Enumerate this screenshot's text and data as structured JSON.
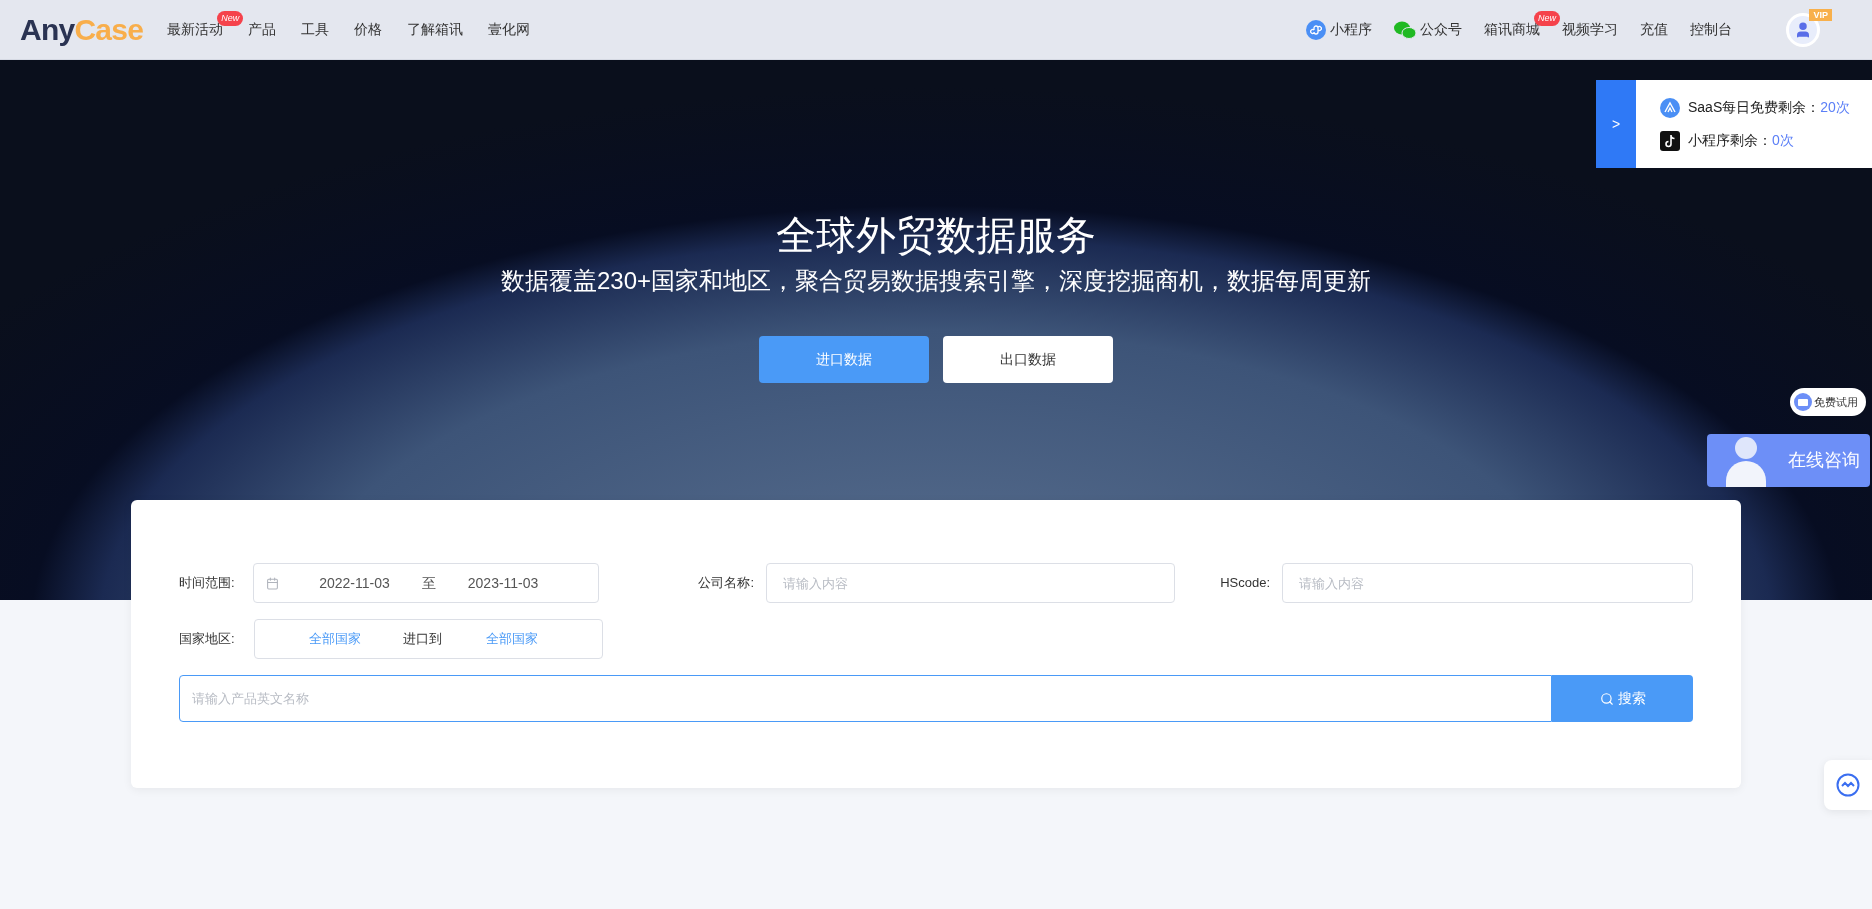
{
  "header": {
    "logo": {
      "first": "A",
      "mid": "ny",
      "last": "Case"
    },
    "nav_left": [
      {
        "label": "最新活动",
        "badge": "New"
      },
      {
        "label": "产品"
      },
      {
        "label": "工具"
      },
      {
        "label": "价格"
      },
      {
        "label": "了解箱讯"
      },
      {
        "label": "壹化网"
      }
    ],
    "nav_right": [
      {
        "kind": "miniprogram",
        "label": "小程序"
      },
      {
        "kind": "wechat",
        "label": "公众号"
      },
      {
        "kind": "plain",
        "label": "箱讯商城",
        "badge": "New"
      },
      {
        "kind": "plain",
        "label": "视频学习"
      },
      {
        "kind": "plain",
        "label": "充值"
      },
      {
        "kind": "plain",
        "label": "控制台"
      }
    ],
    "avatar_badge": "VIP"
  },
  "hero": {
    "title": "全球外贸数据服务",
    "subtitle": "数据覆盖230+国家和地区，聚合贸易数据搜索引擎，深度挖掘商机，数据每周更新",
    "buttons": [
      {
        "label": "进口数据",
        "selected": true
      },
      {
        "label": "出口数据",
        "selected": false
      }
    ]
  },
  "quota_panel": {
    "toggle": ">",
    "rows": [
      {
        "kind": "saas",
        "label": "SaaS每日免费剩余：",
        "value": "20次"
      },
      {
        "kind": "tiktok",
        "label": "小程序剩余：",
        "value": "0次"
      }
    ]
  },
  "search_form": {
    "date_range": {
      "label": "时间范围:",
      "start": "2022-11-03",
      "separator": "至",
      "end": "2023-11-03"
    },
    "company": {
      "label": "公司名称:",
      "placeholder": "请输入内容"
    },
    "hscode": {
      "label": "HScode:",
      "placeholder": "请输入内容"
    },
    "country": {
      "label": "国家地区:",
      "from": "全部国家",
      "between": "进口到",
      "to": "全部国家"
    },
    "product": {
      "placeholder": "请输入产品英文名称"
    },
    "search_button": "搜索"
  },
  "widgets": {
    "free_trial": "免费试用",
    "consult": "在线咨询"
  }
}
